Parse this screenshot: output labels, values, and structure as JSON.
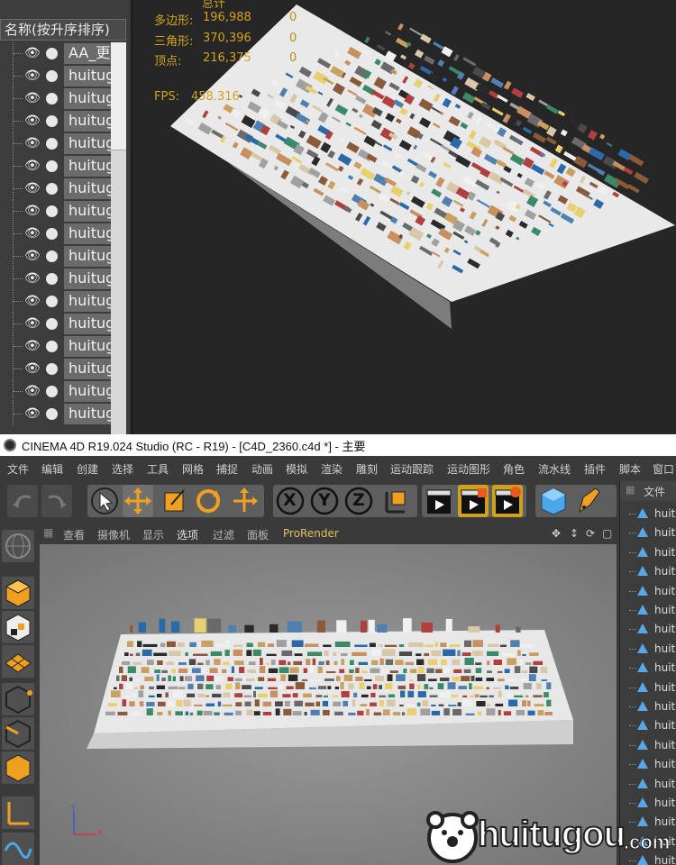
{
  "object_panel": {
    "header": "名称(按升序排序)",
    "rows": [
      "AA_更",
      "huitug",
      "huitug",
      "huitug",
      "huitug",
      "huitug",
      "huitug",
      "huitug",
      "huitug",
      "huitug",
      "huitug",
      "huitug",
      "huitug",
      "huitug",
      "huitug",
      "huitug",
      "huitug"
    ]
  },
  "stats": {
    "header": "总计",
    "polygons_label": "多边形:",
    "polygons_value": "196,988",
    "polygons_sel": "0",
    "triangles_label": "三角形:",
    "triangles_value": "370,396",
    "triangles_sel": "0",
    "vertices_label": "顶点:",
    "vertices_value": "216,375",
    "vertices_sel": "0",
    "fps_label": "FPS:",
    "fps_value": "458.316",
    "color": "#d3a21c"
  },
  "window": {
    "title": "CINEMA 4D R19.024 Studio (RC - R19) - [C4D_2360.c4d *] - 主要"
  },
  "menu": [
    "文件",
    "编辑",
    "创建",
    "选择",
    "工具",
    "网格",
    "捕捉",
    "动画",
    "模拟",
    "渲染",
    "雕刻",
    "运动跟踪",
    "运动图形",
    "角色",
    "流水线",
    "插件",
    "脚本",
    "窗口"
  ],
  "viewport_menu": {
    "items": [
      "查看",
      "摄像机",
      "显示",
      "选项",
      "过滤",
      "面板"
    ],
    "prorender": "ProRender",
    "prorender_color": "#e0c060"
  },
  "toolbar": {
    "axis_x": "X",
    "axis_y": "Y",
    "axis_z": "Z",
    "accent": "#f0a020"
  },
  "right_panel": {
    "header": "文件",
    "rows": [
      "huitu",
      "huitu",
      "huitu",
      "huitu",
      "huitu",
      "huitu",
      "huitu",
      "huitu",
      "huitu",
      "huitu",
      "huitu",
      "huitu",
      "huitu",
      "huitu",
      "huitu",
      "huitu",
      "huitu",
      "huitu",
      "huitu"
    ]
  },
  "axis": {
    "x": "X",
    "y": "Y",
    "z": "Z"
  },
  "watermark": {
    "brand": "huitugou",
    "suffix": ".com"
  }
}
